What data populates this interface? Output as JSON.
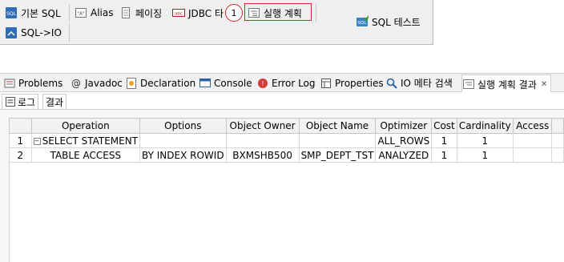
{
  "toolbar": {
    "row1": [
      {
        "label": "기본 SQL",
        "icon": "sql-doc-icon"
      },
      {
        "label": "Alias",
        "icon": "alias-icon"
      },
      {
        "label": "페이징",
        "icon": "paging-icon"
      },
      {
        "label": "JDBC 타",
        "icon": "jdbc-icon"
      },
      {
        "label": "실행 계획",
        "icon": "execution-plan-icon"
      }
    ],
    "row2": [
      {
        "label": "SQL->IO",
        "icon": "sql-io-icon"
      }
    ],
    "sql_test": {
      "label": "SQL 테스트",
      "icon": "sql-test-icon"
    },
    "callout_number": "1"
  },
  "view_tabs": [
    {
      "label": "Problems",
      "icon": "problems-icon"
    },
    {
      "label": "Javadoc",
      "icon": "javadoc-icon"
    },
    {
      "label": "Declaration",
      "icon": "declaration-icon"
    },
    {
      "label": "Console",
      "icon": "console-icon"
    },
    {
      "label": "Error Log",
      "icon": "error-log-icon"
    },
    {
      "label": "Properties",
      "icon": "properties-icon"
    },
    {
      "label": "IO 메타 검색",
      "icon": "io-meta-search-icon"
    },
    {
      "label": "실행 계획 결과",
      "icon": "plan-result-icon",
      "active": true
    }
  ],
  "close_glyph": "✕",
  "sub_tabs": [
    {
      "label": "로그",
      "icon": "log-icon"
    },
    {
      "label": "결과",
      "active": true
    }
  ],
  "grid": {
    "columns": [
      "",
      "Operation",
      "Options",
      "Object Owner",
      "Object Name",
      "Optimizer",
      "Cost",
      "Cardinality",
      "Access"
    ],
    "rows": [
      {
        "num": "1",
        "operation": "SELECT STATEMENT",
        "options": "",
        "object_owner": "",
        "object_name": "",
        "optimizer": "ALL_ROWS",
        "cost": "1",
        "cardinality": "1",
        "access": ""
      },
      {
        "num": "2",
        "operation": "TABLE ACCESS",
        "options": "BY INDEX ROWID",
        "object_owner": "BXMSHB500",
        "object_name": "SMP_DEPT_TST",
        "optimizer": "ANALYZED",
        "cost": "1",
        "cardinality": "1",
        "access": ""
      }
    ],
    "tree_toggle": "⊟"
  }
}
